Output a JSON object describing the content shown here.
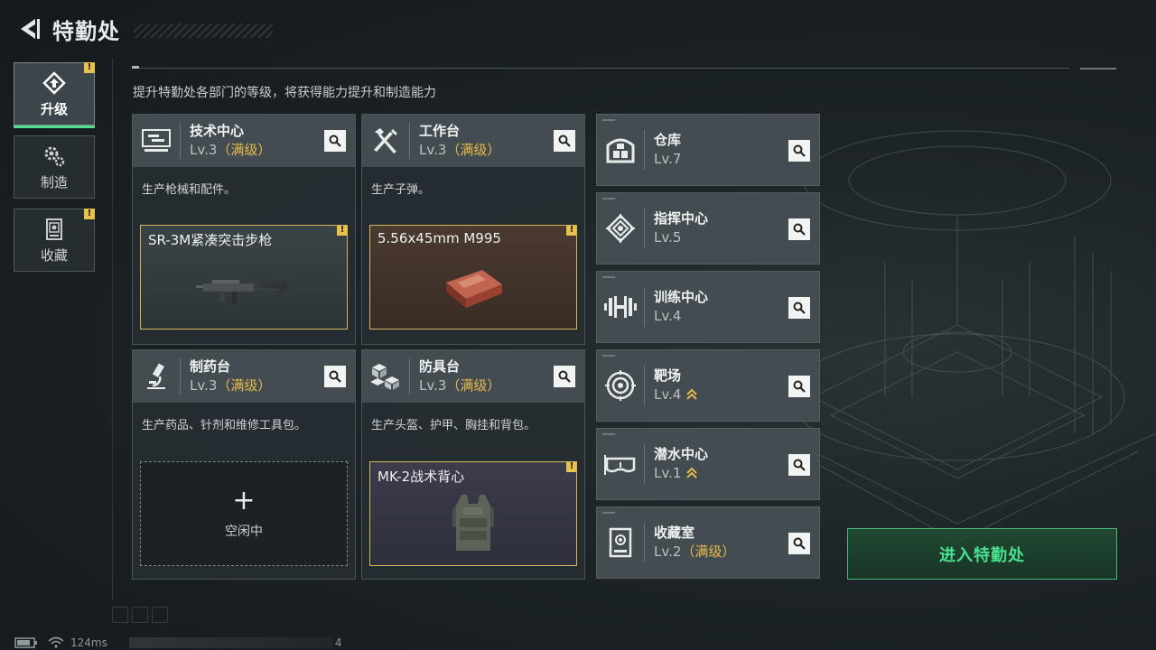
{
  "header": {
    "title": "特勤处",
    "back_icon": "back-arrow-icon"
  },
  "sidebar": {
    "items": [
      {
        "label": "升级",
        "icon": "upgrade-icon",
        "active": true,
        "badge": "!"
      },
      {
        "label": "制造",
        "icon": "gear-icon",
        "active": false,
        "badge": ""
      },
      {
        "label": "收藏",
        "icon": "collection-icon",
        "active": false,
        "badge": "!"
      }
    ]
  },
  "subtitle": "提升特勤处各部门的等级，将获得能力提升和制造能力",
  "departments": [
    {
      "name": "技术中心",
      "level": "Lv.3",
      "max": "（满级）",
      "icon": "tech-center-icon",
      "desc": "生产枪械和配件。",
      "craft": {
        "name": "SR-3M紧凑突击步枪",
        "badge": "!",
        "icon": "rifle-icon"
      }
    },
    {
      "name": "工作台",
      "level": "Lv.3",
      "max": "（满级）",
      "icon": "workbench-icon",
      "desc": "生产子弹。",
      "craft": {
        "name": "5.56x45mm M995",
        "badge": "!",
        "icon": "ammo-box-icon"
      }
    },
    {
      "name": "制药台",
      "level": "Lv.3",
      "max": "（满级）",
      "icon": "microscope-icon",
      "desc": "生产药品、针剂和维修工具包。",
      "idle": {
        "plus": "+",
        "label": "空闲中"
      }
    },
    {
      "name": "防具台",
      "level": "Lv.3",
      "max": "（满级）",
      "icon": "armor-bench-icon",
      "desc": "生产头盔、护甲、胸挂和背包。",
      "craft": {
        "name": "MK-2战术背心",
        "badge": "!",
        "icon": "vest-icon"
      }
    }
  ],
  "side_departments": [
    {
      "name": "仓库",
      "level": "Lv.7",
      "max": "",
      "icon": "warehouse-icon",
      "upgradable": false
    },
    {
      "name": "指挥中心",
      "level": "Lv.5",
      "max": "",
      "icon": "command-center-icon",
      "upgradable": false
    },
    {
      "name": "训练中心",
      "level": "Lv.4",
      "max": "",
      "icon": "dumbbell-icon",
      "upgradable": false
    },
    {
      "name": "靶场",
      "level": "Lv.4",
      "max": "",
      "icon": "target-icon",
      "upgradable": true
    },
    {
      "name": "潜水中心",
      "level": "Lv.1",
      "max": "",
      "icon": "diving-mask-icon",
      "upgradable": true
    },
    {
      "name": "收藏室",
      "level": "Lv.2",
      "max": "（满级）",
      "icon": "collection-room-icon",
      "upgradable": false
    }
  ],
  "enter_button": "进入特勤处",
  "status": {
    "ping": "124ms",
    "page": "4"
  },
  "colors": {
    "accent_green": "#49e08f",
    "max_gold": "#e6b94a",
    "badge_yellow": "#e9c24b"
  }
}
